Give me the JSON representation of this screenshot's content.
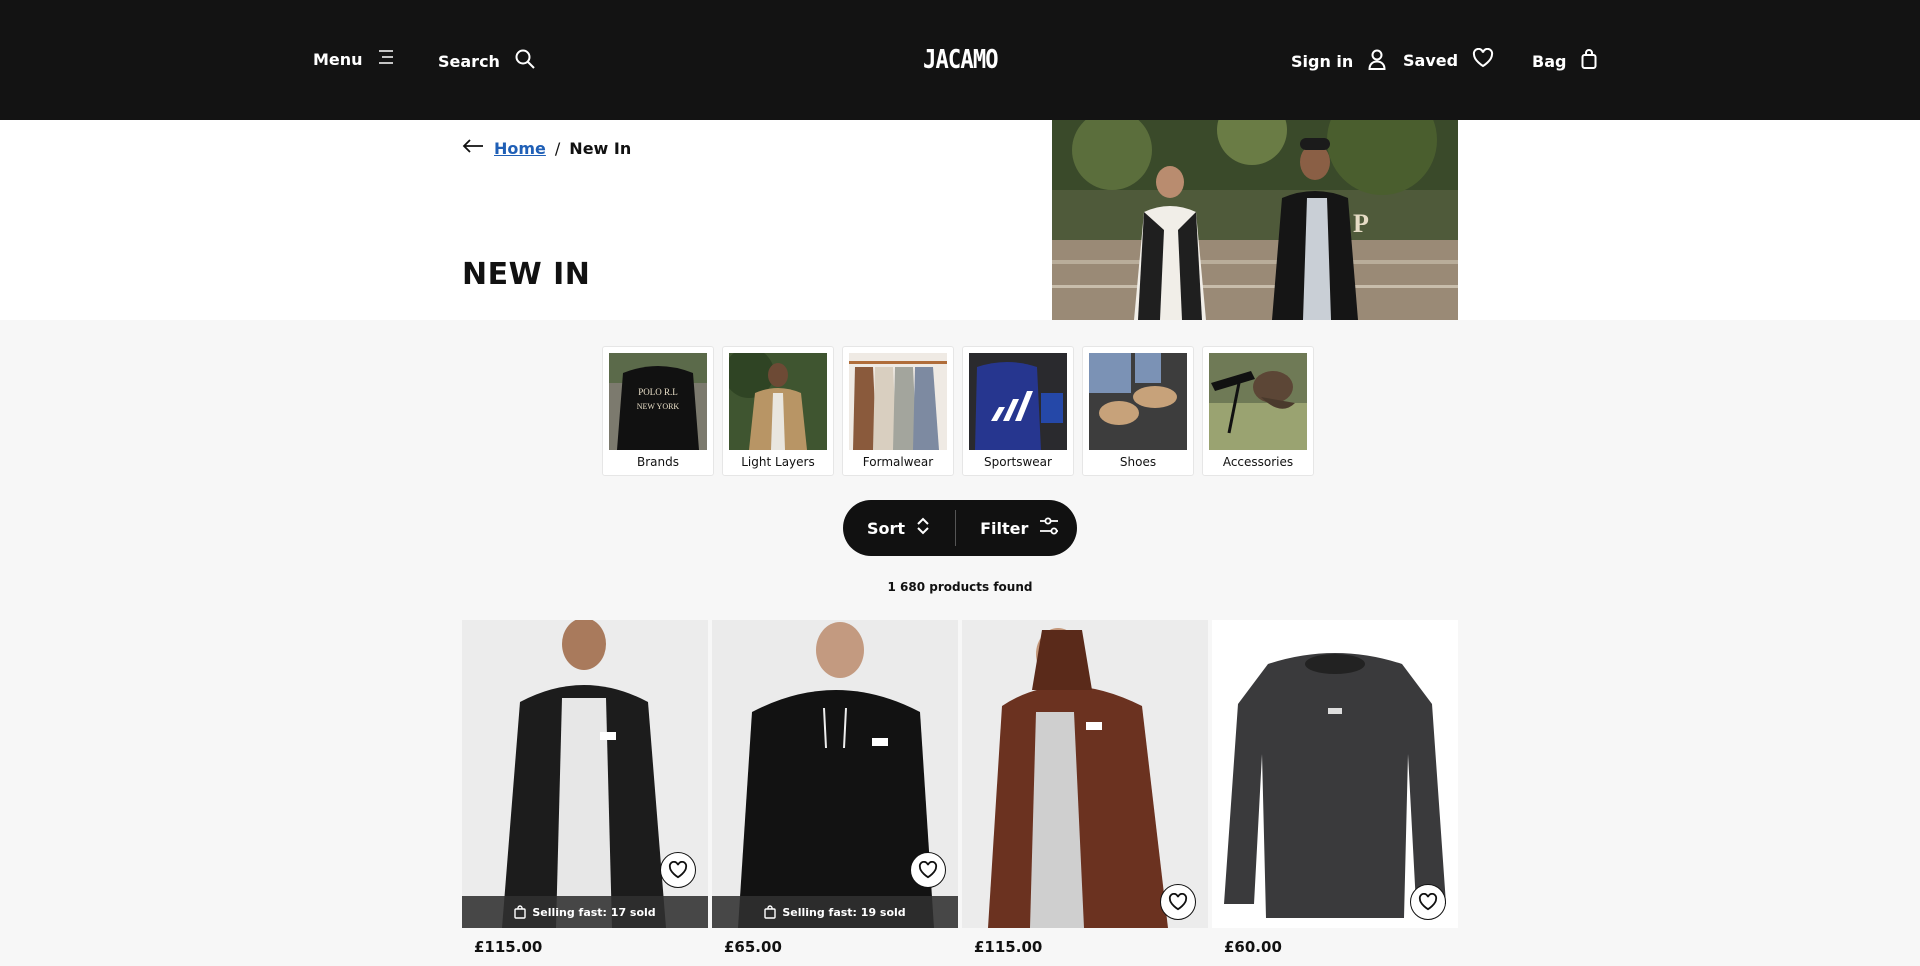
{
  "header": {
    "menu_label": "Menu",
    "search_label": "Search",
    "logo_text": "JACAMO",
    "signin_label": "Sign in",
    "saved_label": "Saved",
    "bag_label": "Bag"
  },
  "breadcrumb": {
    "home_label": "Home",
    "separator": "/",
    "current_label": "New In"
  },
  "page": {
    "title": "NEW IN"
  },
  "categories": [
    {
      "label": "Brands"
    },
    {
      "label": "Light Layers"
    },
    {
      "label": "Formalwear"
    },
    {
      "label": "Sportswear"
    },
    {
      "label": "Shoes"
    },
    {
      "label": "Accessories"
    }
  ],
  "controls": {
    "sort_label": "Sort",
    "filter_label": "Filter"
  },
  "results": {
    "count_text": "1 680 products found"
  },
  "products": [
    {
      "price": "£115.00",
      "badge": "Selling fast: 17 sold",
      "color": "#1a1a1a"
    },
    {
      "price": "£65.00",
      "badge": "Selling fast: 19 sold",
      "color": "#111111"
    },
    {
      "price": "£115.00",
      "badge": "",
      "color": "#6b3220"
    },
    {
      "price": "£60.00",
      "badge": "",
      "color": "#3a3a3c"
    }
  ],
  "colors": {
    "header_bg": "#131313",
    "link": "#1f5fb6",
    "page_bg": "#f7f7f7"
  }
}
